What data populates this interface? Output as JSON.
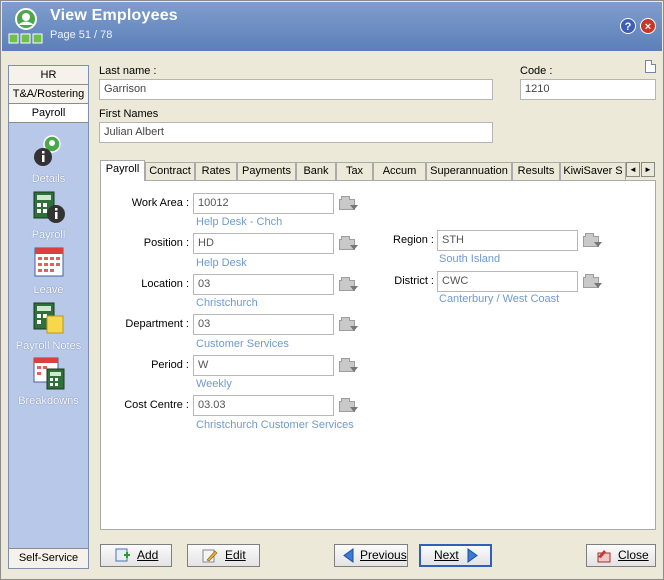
{
  "window": {
    "title": "View Employees",
    "subtitle": "Page 51 / 78",
    "help_symbol": "?",
    "close_symbol": "×"
  },
  "nav": {
    "tabs": [
      "HR",
      "T&A/Rostering",
      "Payroll"
    ],
    "items": [
      {
        "label": "Details",
        "icon": "user-details-icon"
      },
      {
        "label": "Payroll",
        "icon": "calculator-info-icon"
      },
      {
        "label": "Leave",
        "icon": "calendar-icon"
      },
      {
        "label": "Payroll Notes",
        "icon": "calculator-note-icon"
      },
      {
        "label": "Breakdowns",
        "icon": "calendar-calculator-icon"
      }
    ],
    "bottom": "Self-Service"
  },
  "employee": {
    "last_name_label": "Last name :",
    "last_name": "Garrison",
    "code_label": "Code :",
    "code": "1210",
    "first_names_label": "First Names",
    "first_names": "Julian Albert"
  },
  "tabs": [
    "Payroll",
    "Contract",
    "Rates",
    "Payments",
    "Bank",
    "Tax",
    "Accum",
    "Superannuation",
    "Results",
    "KiwiSaver S"
  ],
  "tab_scroll": {
    "left": "◄",
    "right": "►"
  },
  "payroll": {
    "left": [
      {
        "label": "Work Area :",
        "value": "10012",
        "desc": "Help Desk - Chch"
      },
      {
        "label": "Position :",
        "value": "HD",
        "desc": "Help Desk"
      },
      {
        "label": "Location :",
        "value": "03",
        "desc": "Christchurch"
      },
      {
        "label": "Department :",
        "value": "03",
        "desc": "Customer Services"
      },
      {
        "label": "Period :",
        "value": "W",
        "desc": "Weekly"
      },
      {
        "label": "Cost Centre :",
        "value": "03.03",
        "desc": "Christchurch Customer Services"
      }
    ],
    "right": [
      {
        "label": "Region :",
        "value": "STH",
        "desc": "South Island"
      },
      {
        "label": "District :",
        "value": "CWC",
        "desc": "Canterbury / West Coast"
      }
    ]
  },
  "buttons": {
    "add": "Add",
    "edit": "Edit",
    "previous": "Previous",
    "next": "Next",
    "close": "Close"
  }
}
